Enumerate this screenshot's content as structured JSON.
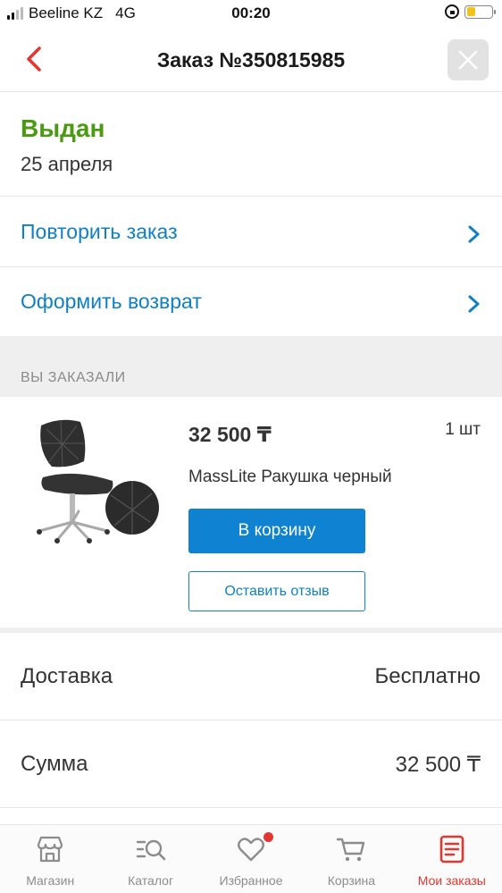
{
  "status_bar": {
    "carrier": "Beeline KZ",
    "network": "4G",
    "time": "00:20",
    "battery_level_fraction": 0.35
  },
  "header": {
    "title": "Заказ №350815985",
    "back_icon": "chevron-left-icon",
    "close_icon": "close-icon"
  },
  "order_status": {
    "status": "Выдан",
    "date": "25 апреля",
    "status_color": "#4a9a12"
  },
  "actions": [
    {
      "label": "Повторить заказ"
    },
    {
      "label": "Оформить возврат"
    }
  ],
  "section_caption": "ВЫ ЗАКАЗАЛИ",
  "product": {
    "price": "32 500 ₸",
    "quantity": "1 шт",
    "name": "MassLite Ракушка черный",
    "cart_button": "В корзину",
    "review_button": "Оставить отзыв"
  },
  "summary": [
    {
      "label": "Доставка",
      "value": "Бесплатно"
    },
    {
      "label": "Сумма",
      "value": "32 500 ₸"
    }
  ],
  "tabs": [
    {
      "label": "Магазин",
      "icon": "store-icon",
      "active": false
    },
    {
      "label": "Каталог",
      "icon": "catalog-search-icon",
      "active": false
    },
    {
      "label": "Избранное",
      "icon": "heart-icon",
      "active": false
    },
    {
      "label": "Корзина",
      "icon": "cart-icon",
      "active": false
    },
    {
      "label": "Мои заказы",
      "icon": "orders-icon",
      "active": true
    }
  ],
  "colors": {
    "accent_blue": "#0f82d2",
    "link_blue": "#0f7fc6",
    "active_red": "#e4362f"
  }
}
